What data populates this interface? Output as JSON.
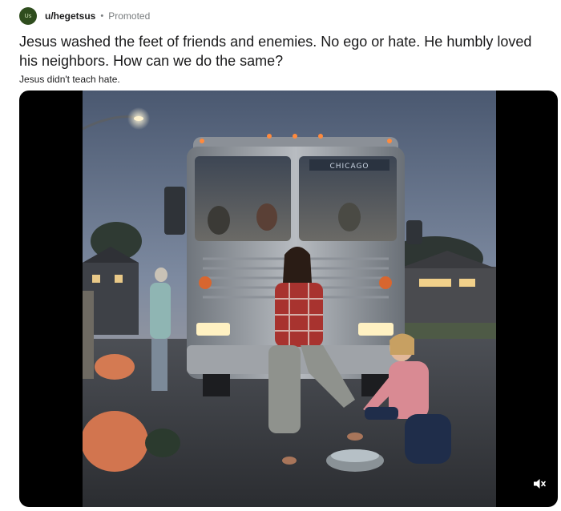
{
  "post": {
    "author": "u/hegetsus",
    "avatar_text": "Us",
    "separator": "•",
    "promoted_label": "Promoted",
    "title": "Jesus washed the feet of friends and enemies. No ego or hate. He humbly loved his neighbors. How can we do the same?",
    "subtitle": "Jesus didn't teach hate."
  },
  "media": {
    "bus_destination_sign": "CHICAGO",
    "mute_icon": "speaker-muted-icon"
  }
}
